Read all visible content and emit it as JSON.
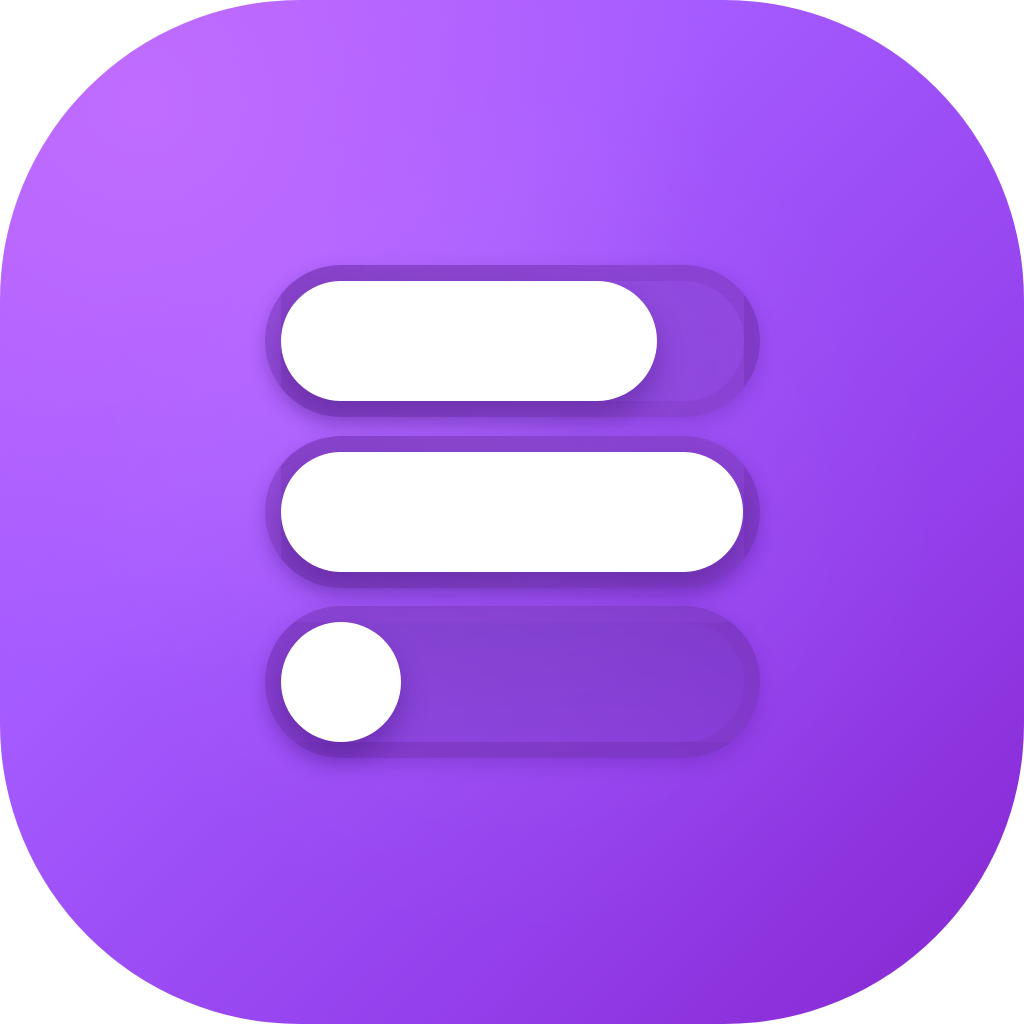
{
  "icon": {
    "name": "toggle-bars-app-icon",
    "colors": {
      "gradient_light": "#c06cff",
      "gradient_mid": "#a45bff",
      "gradient_dark": "#8626cf",
      "track": "#7a3cc3",
      "fill": "#ffffff"
    }
  },
  "bars": [
    {
      "name": "bar-1",
      "progress": 0.78
    },
    {
      "name": "bar-2",
      "progress": 0.96
    },
    {
      "name": "bar-3",
      "progress": 0.0
    }
  ]
}
